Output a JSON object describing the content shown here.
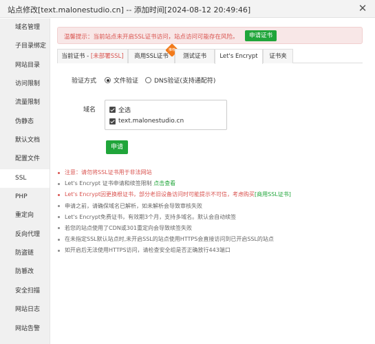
{
  "window": {
    "title": "站点修改[text.malonestudio.cn] -- 添加时间[2024-08-12 20:49:46]",
    "close_glyph": "✕"
  },
  "sidebar": {
    "items": [
      {
        "label": "域名管理"
      },
      {
        "label": "子目录绑定"
      },
      {
        "label": "网站目录"
      },
      {
        "label": "访问限制"
      },
      {
        "label": "流量限制"
      },
      {
        "label": "伪静态"
      },
      {
        "label": "默认文档"
      },
      {
        "label": "配置文件"
      },
      {
        "label": "SSL"
      },
      {
        "label": "PHP"
      },
      {
        "label": "重定向"
      },
      {
        "label": "反向代理"
      },
      {
        "label": "防盗链"
      },
      {
        "label": "防篡改"
      },
      {
        "label": "安全扫描"
      },
      {
        "label": "网站日志"
      },
      {
        "label": "网站告警"
      }
    ],
    "active": "SSL"
  },
  "warning": {
    "text": "温馨提示：当前站点未开启SSL证书访问，站点访问可能存在风险。",
    "button": "申请证书"
  },
  "tabs": {
    "current_prefix": "当前证书 - ",
    "current_status": "[未部署SSL]",
    "commercial": "商用SSL证书",
    "commercial_badge": "推荐",
    "test": "测试证书",
    "letsencrypt": "Let's Encrypt",
    "folder": "证书夹",
    "active": "Let's Encrypt"
  },
  "form": {
    "verify_label": "验证方式",
    "verify_options": [
      {
        "label": "文件验证",
        "selected": true
      },
      {
        "label": "DNS验证(支持通配符)",
        "selected": false
      }
    ],
    "domain_label": "域名",
    "domains": [
      {
        "label": "全选",
        "checked": true
      },
      {
        "label": "text.malonestudio.cn",
        "checked": true
      }
    ],
    "submit": "申请"
  },
  "notes": {
    "n1": "注意：请勿将SSL证书用于非法网站",
    "n2_text": "Let's Encrypt 证书申请和续签限制 ",
    "n2_link": "点击查看",
    "n3_text": "Let's Encrypt因更换根证书，部分老旧设备访问时可能提示不可信，考虑购买",
    "n3_link": "[商用SSL证书]",
    "n4": "申请之前，请确保域名已解析，如未解析会导致审核失败",
    "n5": "Let's Encrypt免费证书，有效期3个月，支持多域名。默认会自动续签",
    "n6": "若您的站点使用了CDN或301重定向会导致续签失败",
    "n7": "在未指定SSL默认站点时,未开启SSL的站点使用HTTPS会直接访问到已开启SSL的站点",
    "n8": "如开启后无法使用HTTPS访问，请检查安全组是否正确放行443端口"
  },
  "colors": {
    "accent_green": "#20a53a",
    "danger_red": "#d9534f",
    "badge_orange": "#f27a1a"
  }
}
